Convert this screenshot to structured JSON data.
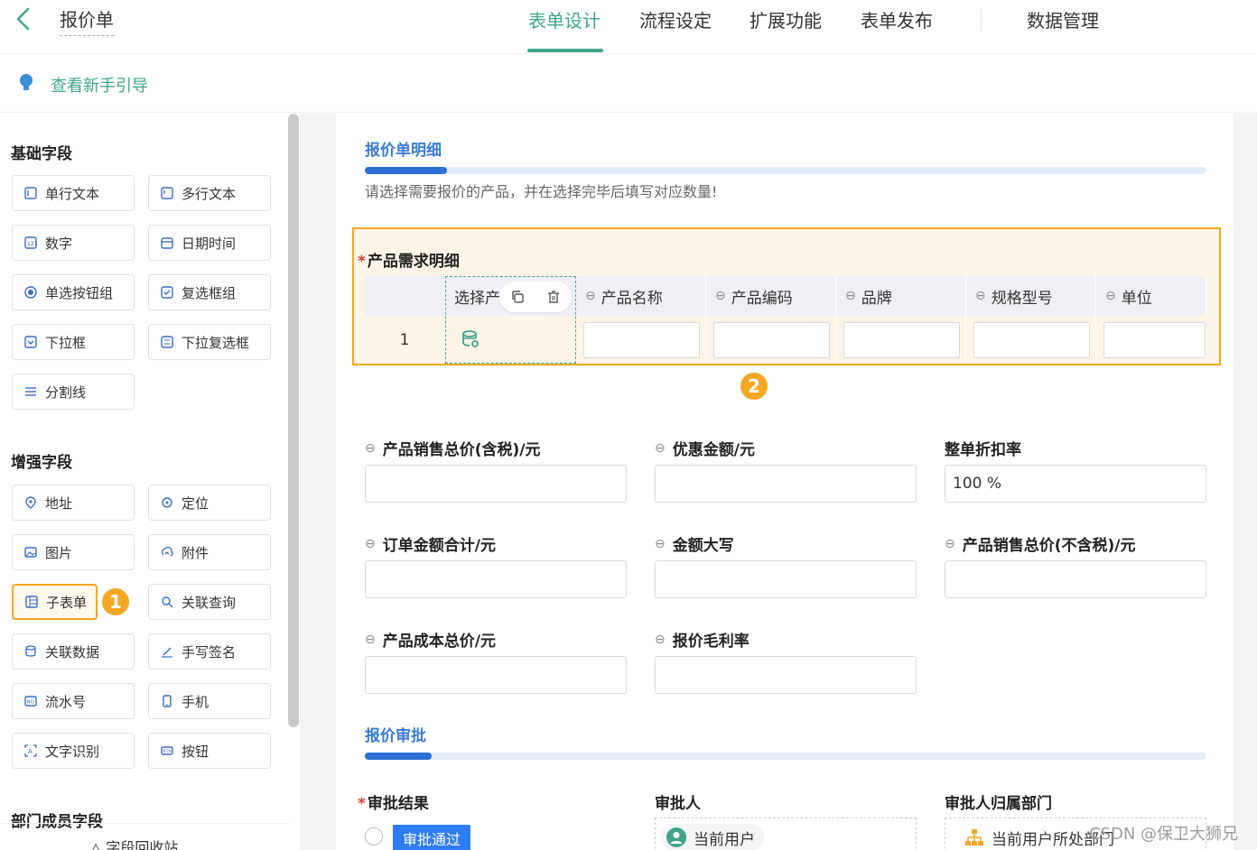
{
  "header": {
    "title": "报价单",
    "tabs": [
      {
        "label": "表单设计",
        "active": true
      },
      {
        "label": "流程设定",
        "active": false
      },
      {
        "label": "扩展功能",
        "active": false
      },
      {
        "label": "表单发布",
        "active": false
      },
      {
        "label": "数据管理",
        "active": false
      }
    ]
  },
  "guide": {
    "label": "查看新手引导"
  },
  "left_panel": {
    "basic_title": "基础字段",
    "basic_fields": [
      {
        "label": "单行文本",
        "icon": "single-line-text-icon"
      },
      {
        "label": "多行文本",
        "icon": "multi-line-text-icon"
      },
      {
        "label": "数字",
        "icon": "number-icon"
      },
      {
        "label": "日期时间",
        "icon": "calendar-icon"
      },
      {
        "label": "单选按钮组",
        "icon": "radio-icon"
      },
      {
        "label": "复选框组",
        "icon": "checkbox-icon"
      },
      {
        "label": "下拉框",
        "icon": "dropdown-icon"
      },
      {
        "label": "下拉复选框",
        "icon": "dropdown-checkbox-icon"
      },
      {
        "label": "分割线",
        "icon": "divider-icon"
      }
    ],
    "enhanced_title": "增强字段",
    "enhanced_fields": [
      {
        "label": "地址",
        "icon": "location-pin-icon"
      },
      {
        "label": "定位",
        "icon": "crosshair-icon"
      },
      {
        "label": "图片",
        "icon": "image-icon"
      },
      {
        "label": "附件",
        "icon": "upload-icon"
      },
      {
        "label": "子表单",
        "icon": "subform-icon"
      },
      {
        "label": "关联查询",
        "icon": "link-query-icon"
      },
      {
        "label": "关联数据",
        "icon": "link-data-icon"
      },
      {
        "label": "手写签名",
        "icon": "pen-icon"
      },
      {
        "label": "流水号",
        "icon": "serial-number-icon"
      },
      {
        "label": "手机",
        "icon": "phone-icon"
      },
      {
        "label": "文字识别",
        "icon": "ocr-icon"
      },
      {
        "label": "按钮",
        "icon": "button-icon"
      }
    ],
    "dept_title": "部门成员字段",
    "recycle_label": "字段回收站",
    "step_badge_1": "1"
  },
  "canvas": {
    "section1_title": "报价单明细",
    "section1_desc": "请选择需要报价的产品，并在选择完毕后填写对应数量!",
    "subform_label": "产品需求明细",
    "subform_columns": [
      "选择产",
      "产品名称",
      "产品编码",
      "品牌",
      "规格型号",
      "单位"
    ],
    "row_number": "1",
    "step_badge_2": "2",
    "fields": [
      {
        "label": "产品销售总价(含税)/元",
        "value": "",
        "linked": true
      },
      {
        "label": "优惠金额/元",
        "value": "",
        "linked": true
      },
      {
        "label": "整单折扣率",
        "value": "100  %",
        "linked": false
      },
      {
        "label": "订单金额合计/元",
        "value": "",
        "linked": true
      },
      {
        "label": "金额大写",
        "value": "",
        "linked": true
      },
      {
        "label": "产品销售总价(不含税)/元",
        "value": "",
        "linked": true
      },
      {
        "label": "产品成本总价/元",
        "value": "",
        "linked": true
      },
      {
        "label": "报价毛利率",
        "value": "",
        "linked": true
      }
    ],
    "section2_title": "报价审批",
    "approval_result_label": "审批结果",
    "approval_pass": "审批通过",
    "approver_label": "审批人",
    "approver_value": "当前用户",
    "approver_dept_label": "审批人归属部门",
    "approver_dept_value": "当前用户所处部门"
  },
  "watermark": "CSDN @保卫大狮兄",
  "colors": {
    "accent": "#3fa58c",
    "blue": "#2e6fd8",
    "highlight": "#f5a623"
  }
}
